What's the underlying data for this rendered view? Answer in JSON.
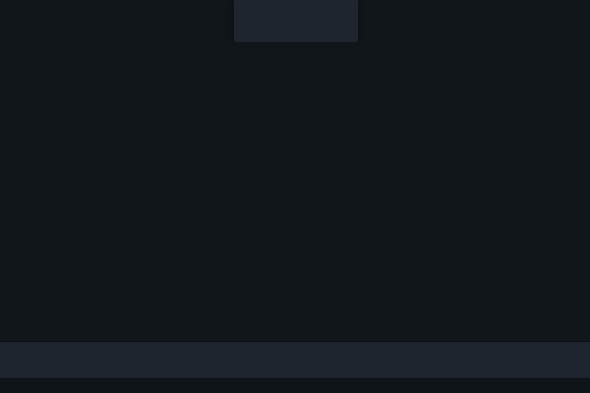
{
  "theme": {
    "background": "#11161b",
    "panel": "#1f252e",
    "bottom_strip": "#0f1419"
  },
  "top_panel": {},
  "main_area": {},
  "bottom_bar": {}
}
